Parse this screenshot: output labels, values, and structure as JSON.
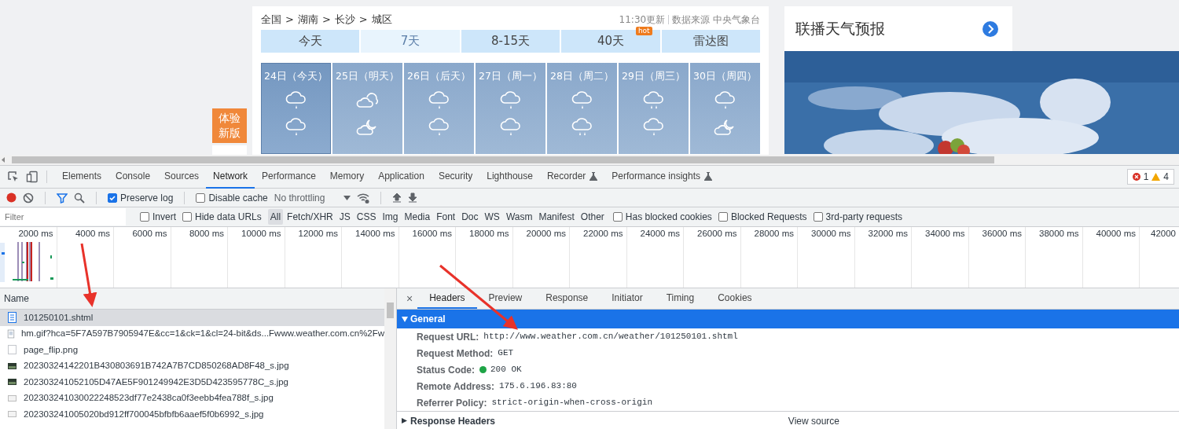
{
  "webpage": {
    "new_version_button": "体验新版",
    "weather": {
      "breadcrumb": {
        "items": [
          "全国",
          "湖南",
          "长沙",
          "城区"
        ],
        "separator": ">"
      },
      "update_time": "11:30更新",
      "source": "数据来源 中央气象台",
      "tabs": [
        {
          "label": "今天",
          "selected": false
        },
        {
          "label": "7天",
          "selected": true
        },
        {
          "label": "8-15天",
          "selected": false
        },
        {
          "label": "40天",
          "selected": false,
          "badge": "hot"
        },
        {
          "label": "雷达图",
          "selected": false
        }
      ],
      "days": [
        {
          "date": "24日（今天）",
          "icons": [
            {
              "kind": "rain"
            },
            {
              "kind": "rain"
            }
          ],
          "selected": true
        },
        {
          "date": "25日（明天）",
          "icons": [
            {
              "kind": "cloudy"
            },
            {
              "kind": "cloudy_night"
            }
          ],
          "selected": false
        },
        {
          "date": "26日（后天）",
          "icons": [
            {
              "kind": "rain"
            },
            {
              "kind": "rain"
            }
          ],
          "selected": false
        },
        {
          "date": "27日（周一）",
          "icons": [
            {
              "kind": "rain"
            },
            {
              "kind": "rain"
            }
          ],
          "selected": false
        },
        {
          "date": "28日（周二）",
          "icons": [
            {
              "kind": "rain"
            },
            {
              "kind": "heavy_rain"
            }
          ],
          "selected": false
        },
        {
          "date": "29日（周三）",
          "icons": [
            {
              "kind": "heavy_rain"
            },
            {
              "kind": "rain"
            }
          ],
          "selected": false
        },
        {
          "date": "30日（周四）",
          "icons": [
            {
              "kind": "rain"
            },
            {
              "kind": "cloudy_night"
            }
          ],
          "selected": false
        }
      ]
    },
    "side_card": {
      "title": "联播天气预报"
    }
  },
  "devtools": {
    "tabs": [
      {
        "label": "Elements",
        "selected": false,
        "experimental": false
      },
      {
        "label": "Console",
        "selected": false,
        "experimental": false
      },
      {
        "label": "Sources",
        "selected": false,
        "experimental": false
      },
      {
        "label": "Network",
        "selected": true,
        "experimental": false
      },
      {
        "label": "Performance",
        "selected": false,
        "experimental": false
      },
      {
        "label": "Memory",
        "selected": false,
        "experimental": false
      },
      {
        "label": "Application",
        "selected": false,
        "experimental": false
      },
      {
        "label": "Security",
        "selected": false,
        "experimental": false
      },
      {
        "label": "Lighthouse",
        "selected": false,
        "experimental": false
      },
      {
        "label": "Recorder",
        "selected": false,
        "experimental": true
      },
      {
        "label": "Performance insights",
        "selected": false,
        "experimental": true
      }
    ],
    "issues": {
      "errors": "1",
      "warnings": "4"
    },
    "toolbar": {
      "recording": true,
      "preserve_log": {
        "label": "Preserve log",
        "checked": true
      },
      "disable_cache": {
        "label": "Disable cache",
        "checked": false
      },
      "throttling": "No throttling"
    },
    "filter": {
      "placeholder": "Filter",
      "options": [
        {
          "label": "Invert",
          "checked": false
        },
        {
          "label": "Hide data URLs",
          "checked": false
        }
      ],
      "types": [
        {
          "label": "All",
          "selected": true
        },
        {
          "label": "Fetch/XHR",
          "selected": false
        },
        {
          "label": "JS",
          "selected": false
        },
        {
          "label": "CSS",
          "selected": false
        },
        {
          "label": "Img",
          "selected": false
        },
        {
          "label": "Media",
          "selected": false
        },
        {
          "label": "Font",
          "selected": false
        },
        {
          "label": "Doc",
          "selected": false
        },
        {
          "label": "WS",
          "selected": false
        },
        {
          "label": "Wasm",
          "selected": false
        },
        {
          "label": "Manifest",
          "selected": false
        },
        {
          "label": "Other",
          "selected": false
        }
      ],
      "more_options": [
        {
          "label": "Has blocked cookies",
          "checked": false
        },
        {
          "label": "Blocked Requests",
          "checked": false
        },
        {
          "label": "3rd-party requests",
          "checked": false
        }
      ]
    },
    "timeline_ticks": [
      "2000 ms",
      "4000 ms",
      "6000 ms",
      "8000 ms",
      "10000 ms",
      "12000 ms",
      "14000 ms",
      "16000 ms",
      "18000 ms",
      "20000 ms",
      "22000 ms",
      "24000 ms",
      "26000 ms",
      "28000 ms",
      "30000 ms",
      "32000 ms",
      "34000 ms",
      "36000 ms",
      "38000 ms",
      "40000 ms",
      "42000"
    ],
    "requests": {
      "column": "Name",
      "rows": [
        {
          "name": "101250101.shtml",
          "kind": "document",
          "selected": true
        },
        {
          "name": "hm.gif?hca=5F7A597B7905947E&cc=1&ck=1&cl=24-bit&ds...Fwww.weather.com.cn%2Fw",
          "kind": "gif",
          "selected": false
        },
        {
          "name": "page_flip.png",
          "kind": "blank",
          "selected": false
        },
        {
          "name": "20230324142201B430803691B742A7B7CD850268AD8F48_s.jpg",
          "selected": false
        },
        {
          "name": "202303241052105D47AE5F901249942E3D5D423595778C_s.jpg",
          "selected": false
        },
        {
          "name": "202303241030022248523df77e2438ca0f3eebb4fea788f_s.jpg",
          "kind": "light-photo",
          "selected": false
        },
        {
          "name": "202303241005020bd912ff700045bfbfb6aaef5f0b6992_s.jpg",
          "kind": "light-photo",
          "selected": false
        }
      ]
    },
    "details": {
      "close": "×",
      "tabs": [
        {
          "label": "Headers",
          "selected": true
        },
        {
          "label": "Preview",
          "selected": false
        },
        {
          "label": "Response",
          "selected": false
        },
        {
          "label": "Initiator",
          "selected": false
        },
        {
          "label": "Timing",
          "selected": false
        },
        {
          "label": "Cookies",
          "selected": false
        }
      ],
      "sections": [
        {
          "title": "General",
          "expanded": true,
          "fields": [
            {
              "label": "Request URL:",
              "value": "http://www.weather.com.cn/weather/101250101.shtml"
            },
            {
              "label": "Request Method:",
              "value": "GET"
            },
            {
              "label": "Status Code:",
              "value": "200 OK",
              "color": "#1ea446"
            },
            {
              "label": "Remote Address:",
              "value": "175.6.196.83:80"
            },
            {
              "label": "Referrer Policy:",
              "value": "strict-origin-when-cross-origin"
            }
          ]
        },
        {
          "title": "Response Headers",
          "expanded": false,
          "action": "View source"
        }
      ]
    }
  }
}
